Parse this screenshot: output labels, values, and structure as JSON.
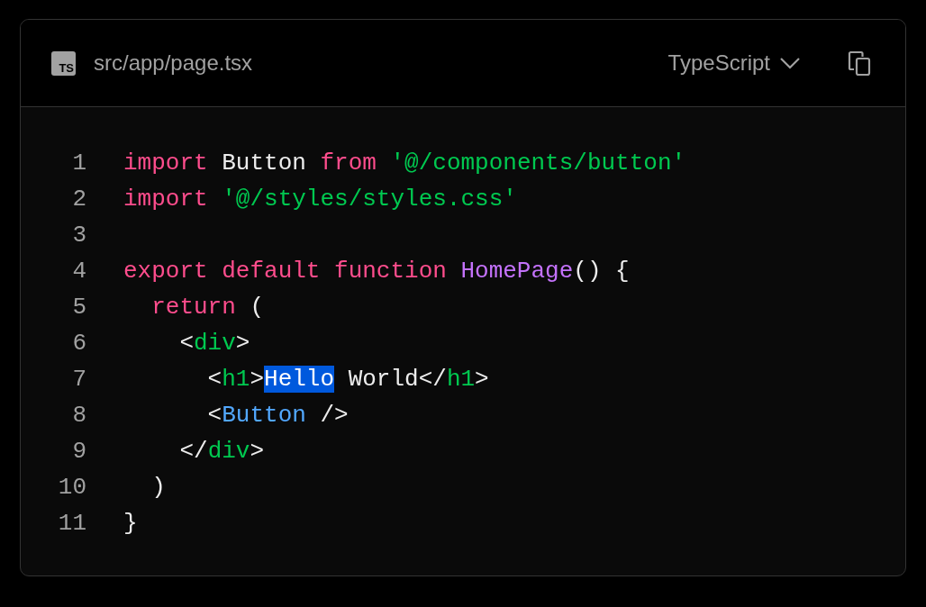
{
  "file": {
    "badge": "TS",
    "path": "src/app/page.tsx"
  },
  "language": {
    "label": "TypeScript"
  },
  "code": [
    {
      "number": "1",
      "tokens": [
        {
          "text": "import",
          "kind": "keyword"
        },
        {
          "text": " Button ",
          "kind": "plain"
        },
        {
          "text": "from",
          "kind": "keyword"
        },
        {
          "text": " '@/components/button'",
          "kind": "string"
        }
      ]
    },
    {
      "number": "2",
      "tokens": [
        {
          "text": "import",
          "kind": "keyword"
        },
        {
          "text": " '@/styles/styles.css'",
          "kind": "string"
        }
      ]
    },
    {
      "number": "3"
    },
    {
      "number": "4",
      "tokens": [
        {
          "text": "export default function",
          "kind": "keyword"
        },
        {
          "text": " HomePage",
          "kind": "function"
        },
        {
          "text": "() {",
          "kind": "plain"
        }
      ]
    },
    {
      "number": "5",
      "tokens": [
        {
          "text": "  return",
          "kind": "keyword"
        },
        {
          "text": " (",
          "kind": "plain"
        }
      ]
    },
    {
      "number": "6",
      "tokens": [
        {
          "text": "    <",
          "kind": "plain"
        },
        {
          "text": "div",
          "kind": "tag"
        },
        {
          "text": ">",
          "kind": "plain"
        }
      ]
    },
    {
      "number": "7",
      "tokens": [
        {
          "text": "      <",
          "kind": "plain"
        },
        {
          "text": "h1",
          "kind": "tag"
        },
        {
          "text": ">",
          "kind": "plain"
        },
        {
          "text": "Hello",
          "kind": "selection"
        },
        {
          "text": " World</",
          "kind": "plain"
        },
        {
          "text": "h1",
          "kind": "tag"
        },
        {
          "text": ">",
          "kind": "plain"
        }
      ]
    },
    {
      "number": "8",
      "tokens": [
        {
          "text": "      <",
          "kind": "plain"
        },
        {
          "text": "Button",
          "kind": "component"
        },
        {
          "text": " />",
          "kind": "plain"
        }
      ]
    },
    {
      "number": "9",
      "tokens": [
        {
          "text": "    </",
          "kind": "plain"
        },
        {
          "text": "div",
          "kind": "tag"
        },
        {
          "text": ">",
          "kind": "plain"
        }
      ]
    },
    {
      "number": "10",
      "tokens": [
        {
          "text": "  )",
          "kind": "plain"
        }
      ]
    },
    {
      "number": "11",
      "tokens": [
        {
          "text": "}",
          "kind": "plain"
        }
      ]
    }
  ]
}
